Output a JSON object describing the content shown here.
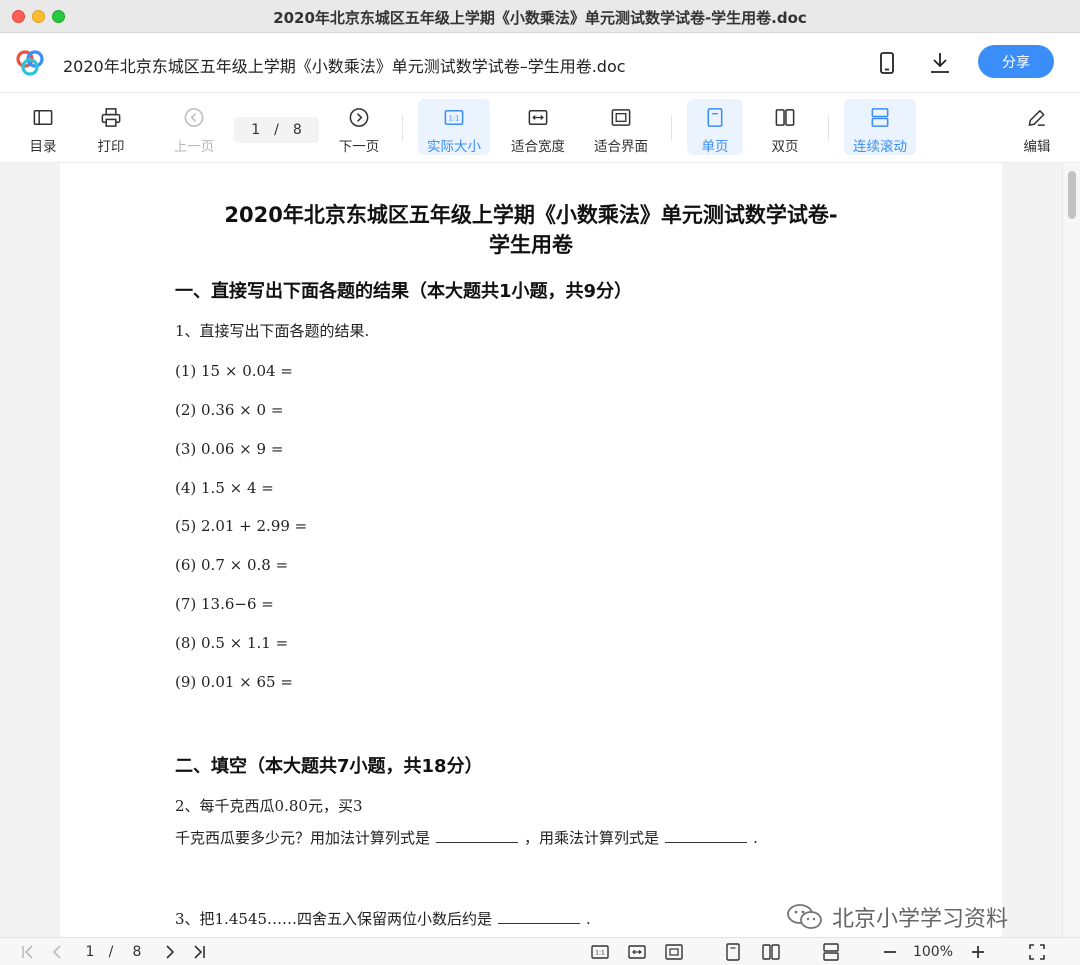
{
  "window": {
    "title": "2020年北京东城区五年级上学期《小数乘法》单元测试数学试卷-学生用卷.doc"
  },
  "header": {
    "doc_title": "2020年北京东城区五年级上学期《小数乘法》单元测试数学试卷–学生用卷.doc",
    "share_label": "分享",
    "accent_color": "#3b8ef7"
  },
  "toolbar": {
    "toc": "目录",
    "print": "打印",
    "prev": "上一页",
    "page_current": "1",
    "page_sep": "/",
    "page_total": "8",
    "next": "下一页",
    "actual_size": "实际大小",
    "fit_width": "适合宽度",
    "fit_screen": "适合界面",
    "single_page": "单页",
    "double_page": "双页",
    "continuous": "连续滚动",
    "edit": "编辑"
  },
  "document": {
    "title_line1": "2020年北京东城区五年级上学期《小数乘法》单元测试数学试卷-",
    "title_line2": "学生用卷",
    "section1": "一、直接写出下面各题的结果（本大题共1小题，共9分）",
    "q1": "1、直接写出下面各题的结果.",
    "q1_items": [
      "(1) 15 × 0.04 =",
      "(2) 0.36 × 0 =",
      "(3) 0.06 × 9 =",
      "(4) 1.5 × 4 =",
      "(5) 2.01 + 2.99 =",
      "(6) 0.7 × 0.8 =",
      "(7) 13.6−6 =",
      "(8) 0.5 × 1.1 =",
      "(9) 0.01 × 65 ="
    ],
    "section2": "二、填空（本大题共7小题，共18分）",
    "q2_line1": "2、每千克西瓜0.80元，买3",
    "q2_line2a": "千克西瓜要多少元？用加法计算列式是",
    "q2_line2b": "，用乘法计算列式是",
    "q2_line2c": ".",
    "q3_a": "3、把1.4545……四舍五入保留两位小数后约是",
    "q3_b": "."
  },
  "watermark": {
    "text": "北京小学学习资料"
  },
  "bottombar": {
    "page_current": "1",
    "page_sep": "/",
    "page_total": "8",
    "zoom": "100%"
  }
}
